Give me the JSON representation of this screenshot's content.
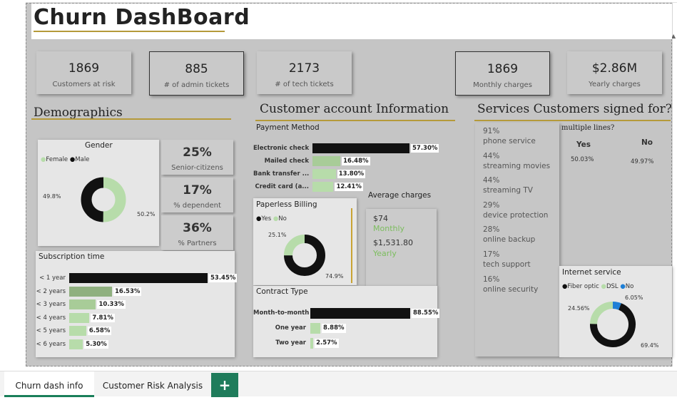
{
  "report": {
    "title": "Churn DashBoard"
  },
  "kpis": [
    {
      "value": "1869",
      "label": "Customers at risk"
    },
    {
      "value": "885",
      "label": "# of admin tickets"
    },
    {
      "value": "2173",
      "label": "# of tech tickets"
    },
    {
      "value": "1869",
      "label": "Monthly charges"
    },
    {
      "value": "$2.86M",
      "label": "Yearly charges"
    }
  ],
  "sections": {
    "demographics": "Demographics",
    "account": "Customer account Information",
    "services": "Services Customers signed for?"
  },
  "gender": {
    "title": "Gender",
    "legend": [
      "Female",
      "Male"
    ],
    "female_pct": 50.2,
    "male_pct": 49.8,
    "female_label": "50.2%",
    "male_label": "49.8%",
    "colors": {
      "female": "#b7dcaa",
      "male": "#111111"
    }
  },
  "demo_stats": [
    {
      "value": "25%",
      "label": "Senior-citizens"
    },
    {
      "value": "17%",
      "label": "% dependent"
    },
    {
      "value": "36%",
      "label": "% Partners"
    }
  ],
  "subscription": {
    "title": "Subscription time",
    "rows": [
      {
        "label": "< 1 year",
        "pct": 53.45,
        "text": "53.45%",
        "color": "#111111"
      },
      {
        "label": "< 2 years",
        "pct": 16.53,
        "text": "16.53%",
        "color": "#8fb07f"
      },
      {
        "label": "< 3 years",
        "pct": 10.33,
        "text": "10.33%",
        "color": "#a8cc98"
      },
      {
        "label": "< 4 years",
        "pct": 7.81,
        "text": "7.81%",
        "color": "#b7dcaa"
      },
      {
        "label": "< 5 years",
        "pct": 6.58,
        "text": "6.58%",
        "color": "#b7dcaa"
      },
      {
        "label": "< 6 years",
        "pct": 5.3,
        "text": "5.30%",
        "color": "#b7dcaa"
      }
    ]
  },
  "payment": {
    "title": "Payment Method",
    "rows": [
      {
        "label": "Electronic check",
        "pct": 57.3,
        "text": "57.30%",
        "color": "#111111"
      },
      {
        "label": "Mailed check",
        "pct": 16.48,
        "text": "16.48%",
        "color": "#a8cc98"
      },
      {
        "label": "Bank transfer ...",
        "pct": 13.8,
        "text": "13.80%",
        "color": "#b7dcaa"
      },
      {
        "label": "Credit card (a...",
        "pct": 12.41,
        "text": "12.41%",
        "color": "#b7dcaa"
      }
    ]
  },
  "avg_charges": {
    "title": "Average charges",
    "monthly_value": "$74",
    "monthly_label": "Monthly",
    "yearly_value": "$1,531.80",
    "yearly_label": "Yearly"
  },
  "paperless": {
    "title": "Paperless Billing",
    "legend": [
      "Yes",
      "No"
    ],
    "yes_pct": 74.9,
    "no_pct": 25.1,
    "yes_label": "74.9%",
    "no_label": "25.1%",
    "colors": {
      "yes": "#111111",
      "no": "#b7dcaa"
    }
  },
  "contract": {
    "title": "Contract Type",
    "rows": [
      {
        "label": "Month-to-month",
        "pct": 88.55,
        "text": "88.55%",
        "color": "#111111"
      },
      {
        "label": "One year",
        "pct": 8.88,
        "text": "8.88%",
        "color": "#b7dcaa"
      },
      {
        "label": "Two year",
        "pct": 2.57,
        "text": "2.57%",
        "color": "#b7dcaa"
      }
    ]
  },
  "services": [
    {
      "pct": "91%",
      "label": "phone service"
    },
    {
      "pct": "44%",
      "label": "streaming movies"
    },
    {
      "pct": "44%",
      "label": "streaming TV"
    },
    {
      "pct": "29%",
      "label": "device protection"
    },
    {
      "pct": "28%",
      "label": "online backup"
    },
    {
      "pct": "17%",
      "label": "tech support"
    },
    {
      "pct": "16%",
      "label": "online security"
    }
  ],
  "multiple_lines": {
    "title": "multiple lines?",
    "yes_label": "Yes",
    "no_label": "No",
    "yes_value": "50.03%",
    "no_value": "49.97%"
  },
  "internet": {
    "title": "Internet service",
    "legend": [
      "Fiber optic",
      "DSL",
      "No"
    ],
    "fiber_pct": 69.4,
    "dsl_pct": 24.56,
    "no_pct": 6.05,
    "fiber_label": "69.4%",
    "dsl_label": "24.56%",
    "no_label": "6.05%",
    "colors": {
      "fiber": "#111111",
      "dsl": "#b7dcaa",
      "no": "#1e7fd6"
    }
  },
  "tabs": {
    "tab1": "Churn dash info",
    "tab2": "Customer Risk Analysis",
    "add": "+"
  }
}
